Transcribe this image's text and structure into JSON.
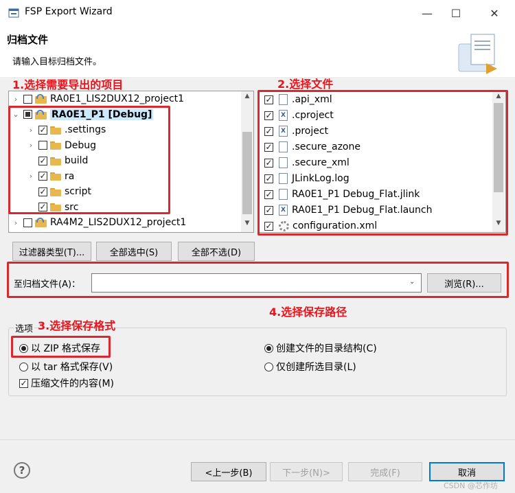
{
  "window": {
    "title": "FSP Export Wizard",
    "minimize": "—",
    "maximize": "☐",
    "close": "✕"
  },
  "header": {
    "title": "归档文件",
    "description": "请输入目标归档文件。"
  },
  "annotations": {
    "a1": "1.选择需要导出的项目",
    "a2": "2.选择文件",
    "a3": "3.选择保存格式",
    "a4": "4.选择保存路径"
  },
  "tree": [
    {
      "label": "RA0E1_LIS2DUX12_project1",
      "state": "unchecked",
      "expander": "›",
      "kind": "project"
    },
    {
      "label": "RA0E1_P1 [Debug]",
      "state": "partial",
      "expander": "⌄",
      "kind": "project",
      "selected": true
    },
    {
      "label": ".settings",
      "state": "checked",
      "expander": "›",
      "kind": "folder"
    },
    {
      "label": "Debug",
      "state": "unchecked",
      "expander": "›",
      "kind": "folder"
    },
    {
      "label": "build",
      "state": "checked",
      "expander": "",
      "kind": "folder"
    },
    {
      "label": "ra",
      "state": "checked",
      "expander": "›",
      "kind": "folder"
    },
    {
      "label": "script",
      "state": "checked",
      "expander": "",
      "kind": "folder"
    },
    {
      "label": "src",
      "state": "checked",
      "expander": "",
      "kind": "folder"
    },
    {
      "label": "RA4M2_LIS2DUX12_project1",
      "state": "unchecked",
      "expander": "›",
      "kind": "project"
    }
  ],
  "files": [
    {
      "label": ".api_xml",
      "icon": "doc"
    },
    {
      "label": ".cproject",
      "icon": "x"
    },
    {
      "label": ".project",
      "icon": "x"
    },
    {
      "label": ".secure_azone",
      "icon": "doc"
    },
    {
      "label": ".secure_xml",
      "icon": "doc"
    },
    {
      "label": "JLinkLog.log",
      "icon": "doc"
    },
    {
      "label": "RA0E1_P1 Debug_Flat.jlink",
      "icon": "doc"
    },
    {
      "label": "RA0E1_P1 Debug_Flat.launch",
      "icon": "x"
    },
    {
      "label": "configuration.xml",
      "icon": "gear"
    }
  ],
  "buttons": {
    "filter": "过滤器类型(T)...",
    "select_all": "全部选中(S)",
    "deselect_all": "全部不选(D)",
    "browse": "浏览(R)...",
    "back": "<上一步(B)",
    "next": "下一步(N)>",
    "finish": "完成(F)",
    "cancel": "取消"
  },
  "archive": {
    "label": "至归档文件(A)：",
    "value": ""
  },
  "options": {
    "group_label": "选项",
    "zip": "以 ZIP 格式保存",
    "tar": "以 tar 格式保存(V)",
    "compress": "压缩文件的内容(M)",
    "create_structure": "创建文件的目录结构(C)",
    "create_selected": "仅创建所选目录(L)"
  },
  "watermark": "CSDN @芯作坊",
  "help": "?"
}
